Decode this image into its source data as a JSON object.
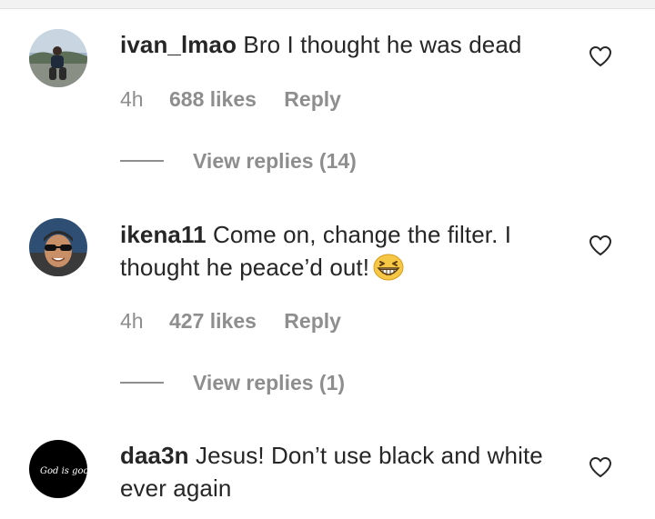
{
  "comments": [
    {
      "username": "ivan_lmao",
      "text": "Bro I thought he was dead",
      "time": "4h",
      "likes": "688 likes",
      "reply": "Reply",
      "view_replies": "View replies (14)"
    },
    {
      "username": "ikena11",
      "text": "Come on, change the filter. I thought he peace’d out!",
      "emoji": "grinning-squinting-face",
      "time": "4h",
      "likes": "427 likes",
      "reply": "Reply",
      "view_replies": "View replies (1)"
    },
    {
      "username": "daa3n",
      "text": "Jesus! Don’t use black and white ever again",
      "avatar_text": "God is good"
    }
  ],
  "colors": {
    "text": "#262626",
    "secondary": "#8e8e8e",
    "background": "#ffffff"
  },
  "icons": {
    "like": "heart-outline-icon"
  }
}
